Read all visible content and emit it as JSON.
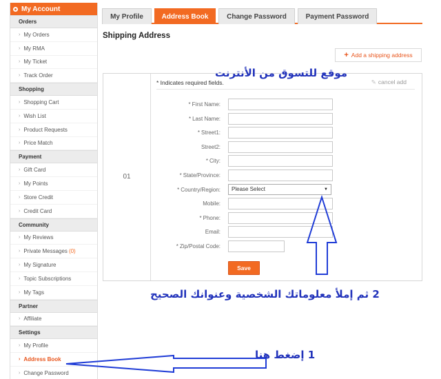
{
  "sidebar": {
    "header": "My Account",
    "sections": [
      {
        "title": "Orders",
        "items": [
          {
            "label": "My Orders"
          },
          {
            "label": "My RMA"
          },
          {
            "label": "My Ticket"
          },
          {
            "label": "Track Order"
          }
        ]
      },
      {
        "title": "Shopping",
        "items": [
          {
            "label": "Shopping Cart"
          },
          {
            "label": "Wish List"
          },
          {
            "label": "Product Requests"
          },
          {
            "label": "Price Match"
          }
        ]
      },
      {
        "title": "Payment",
        "items": [
          {
            "label": "Gift Card"
          },
          {
            "label": "My Points"
          },
          {
            "label": "Store Credit"
          },
          {
            "label": "Credit Card"
          }
        ]
      },
      {
        "title": "Community",
        "items": [
          {
            "label": "My Reviews"
          },
          {
            "label": "Private Messages",
            "count": "(0)"
          },
          {
            "label": "My Signature"
          },
          {
            "label": "Topic Subscriptions"
          },
          {
            "label": "My Tags"
          }
        ]
      },
      {
        "title": "Partner",
        "items": [
          {
            "label": "Affiliate"
          }
        ]
      },
      {
        "title": "Settings",
        "items": [
          {
            "label": "My Profile"
          },
          {
            "label": "Address Book",
            "active": true
          },
          {
            "label": "Change Password"
          }
        ]
      }
    ]
  },
  "tabs": [
    {
      "label": "My Profile",
      "active": false
    },
    {
      "label": "Address Book",
      "active": true
    },
    {
      "label": "Change Password",
      "active": false
    },
    {
      "label": "Payment Password",
      "active": false
    }
  ],
  "page_title": "Shipping Address",
  "add_button": "Add a shipping address",
  "form": {
    "index": "01",
    "required_note": "* Indicates required fields.",
    "cancel_label": "cancel add",
    "fields": [
      {
        "label": "First Name:",
        "required": true,
        "type": "text",
        "value": ""
      },
      {
        "label": "Last Name:",
        "required": true,
        "type": "text",
        "value": ""
      },
      {
        "label": "Street1:",
        "required": true,
        "type": "text",
        "value": ""
      },
      {
        "label": "Street2:",
        "required": false,
        "type": "text",
        "value": ""
      },
      {
        "label": "City:",
        "required": true,
        "type": "text",
        "value": ""
      },
      {
        "label": "State/Province:",
        "required": true,
        "type": "text",
        "value": ""
      },
      {
        "label": "Country/Region:",
        "required": true,
        "type": "select",
        "value": "Please Select"
      },
      {
        "label": "Mobile:",
        "required": false,
        "type": "text",
        "value": ""
      },
      {
        "label": "Phone:",
        "required": true,
        "type": "text",
        "value": ""
      },
      {
        "label": "Email:",
        "required": false,
        "type": "text",
        "value": ""
      },
      {
        "label": "Zip/Postal Code:",
        "required": true,
        "type": "short",
        "value": ""
      }
    ],
    "save_label": "Save"
  },
  "annotations": {
    "site": "موقع للتسوق من الأنترنت",
    "step2": "2 ثم إملأ معلوماتك الشخصية وعنوانك الصحيح",
    "step1": "1 إضغط هنا"
  },
  "colors": {
    "accent": "#f26a22",
    "annotation": "#2233bb"
  }
}
